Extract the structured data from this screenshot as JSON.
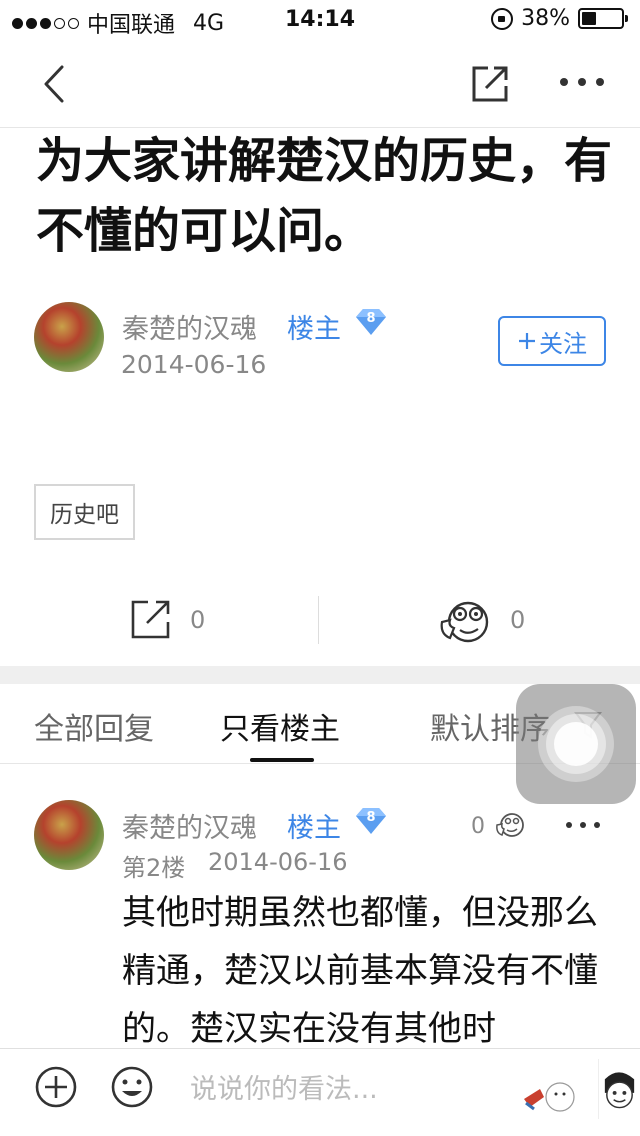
{
  "status_bar": {
    "carrier": "中国联通",
    "network": "4G",
    "time": "14:14",
    "battery_text": "38%",
    "battery_level": 0.38
  },
  "navbar": {
    "icons": [
      "back-icon",
      "share-icon",
      "more-icon"
    ]
  },
  "post": {
    "title": "为大家讲解楚汉的历史，有不懂的可以问。",
    "author": "秦楚的汉魂",
    "owner_tag": "楼主",
    "level": "8",
    "date": "2014-06-16",
    "follow_label": "关注",
    "forum_tag": "历史吧",
    "share_count": "0",
    "like_count": "0"
  },
  "tabs": [
    {
      "label": "全部回复"
    },
    {
      "label": "只看楼主"
    },
    {
      "label": "默认排序"
    }
  ],
  "reply": {
    "author": "秦楚的汉魂",
    "owner_tag": "楼主",
    "level": "8",
    "floor": "第2楼",
    "date": "2014-06-16",
    "like_count": "0",
    "text": "其他时期虽然也都懂，但没那么精通，楚汉以前基本算没有不懂的。楚汉实在没有其他时"
  },
  "bottom_bar": {
    "placeholder": "说说你的看法..."
  },
  "colors": {
    "accent": "#3d86e6",
    "text": "#111111",
    "muted": "#888888"
  }
}
